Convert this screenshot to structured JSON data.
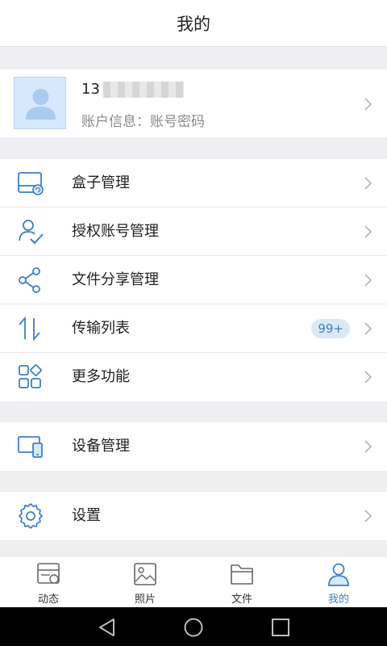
{
  "header": {
    "title": "我的"
  },
  "profile": {
    "phone_prefix": "13",
    "account_label": "账户信息：账号密码"
  },
  "menu_group1": [
    {
      "label": "盒子管理",
      "icon": "box-icon"
    },
    {
      "label": "授权账号管理",
      "icon": "user-check-icon"
    },
    {
      "label": "文件分享管理",
      "icon": "share-icon"
    },
    {
      "label": "传输列表",
      "icon": "transfer-icon",
      "badge": "99+"
    },
    {
      "label": "更多功能",
      "icon": "grid-icon"
    }
  ],
  "menu_group2": [
    {
      "label": "设备管理",
      "icon": "devices-icon"
    }
  ],
  "menu_group3": [
    {
      "label": "设置",
      "icon": "gear-icon"
    }
  ],
  "tabbar": [
    {
      "label": "动态",
      "icon": "activity-icon",
      "active": false
    },
    {
      "label": "照片",
      "icon": "photo-icon",
      "active": false
    },
    {
      "label": "文件",
      "icon": "folder-icon",
      "active": false
    },
    {
      "label": "我的",
      "icon": "person-icon",
      "active": true
    }
  ],
  "colors": {
    "accent": "#3c7fc8",
    "badge_bg": "#dbe9f7",
    "avatar_bg": "#d6e8fb"
  }
}
